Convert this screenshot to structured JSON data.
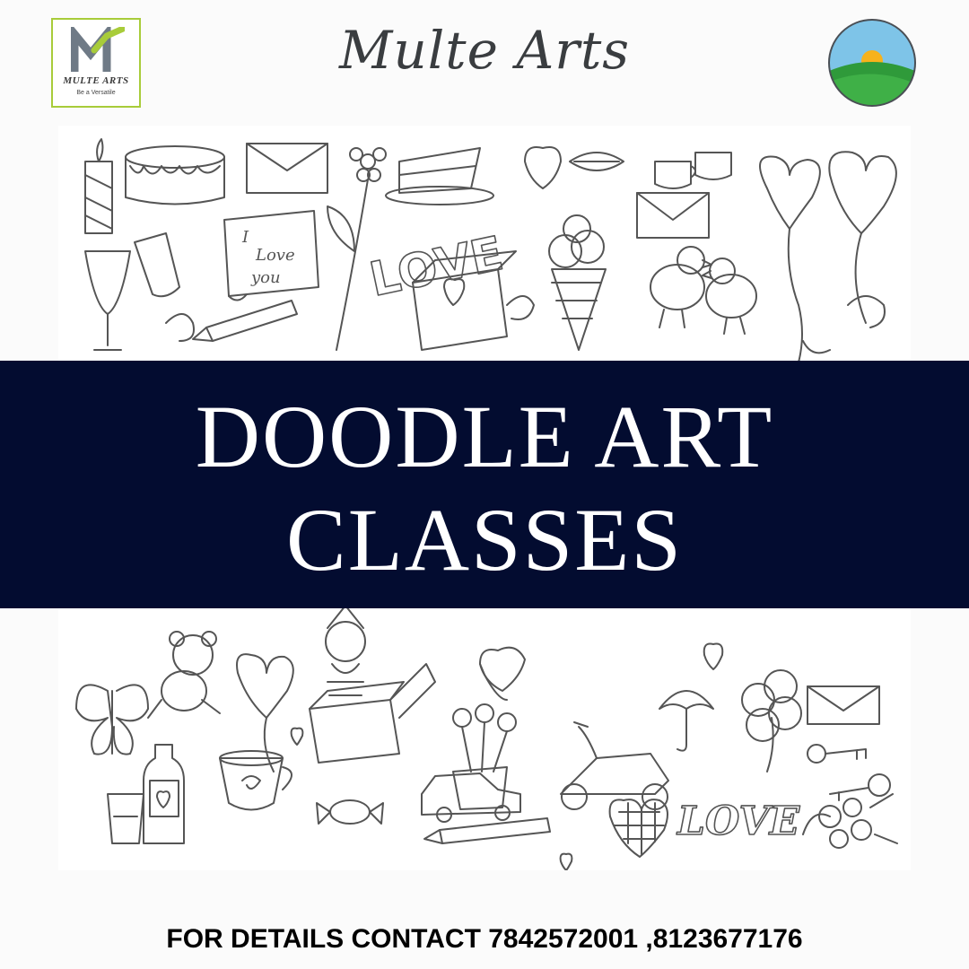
{
  "header": {
    "logo_name": "MULTE ARTS",
    "logo_tagline": "Be a Versatile",
    "brand_title": "Multe Arts"
  },
  "banner": {
    "line1": "DOODLE ART",
    "line2": "CLASSES"
  },
  "doodle": {
    "love_word_top": "LOVE",
    "note_line1": "I",
    "note_line2": "Love",
    "note_line3": "you",
    "love_word_bottom": "LOVE"
  },
  "footer": {
    "contact": "FOR DETAILS CONTACT 7842572001 ,8123677176"
  },
  "colors": {
    "banner_bg": "#030c30",
    "logo_green": "#a8cc3a",
    "doodle_stroke": "#555555"
  },
  "icons": [
    "multe-arts-logo-icon",
    "sunrise-hill-logo-icon"
  ]
}
